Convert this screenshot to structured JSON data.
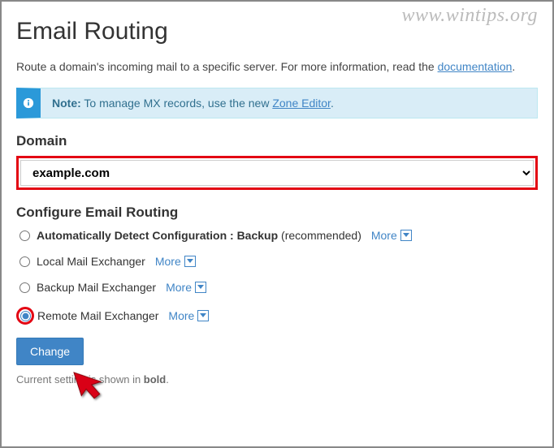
{
  "watermark": "www.wintips.org",
  "page_title": "Email Routing",
  "intro_text_a": "Route a domain's incoming mail to a specific server. For more information, read the ",
  "intro_link": "documentation",
  "intro_text_b": ".",
  "info": {
    "note_label": "Note:",
    "text_a": " To manage MX records, use the new ",
    "link": "Zone Editor",
    "text_b": "."
  },
  "domain": {
    "label": "Domain",
    "selected": "example.com"
  },
  "configure_label": "Configure Email Routing",
  "options": [
    {
      "label": "Automatically Detect Configuration : Backup",
      "recommended": " (recommended)",
      "more": "More"
    },
    {
      "label": "Local Mail Exchanger",
      "more": "More"
    },
    {
      "label": "Backup Mail Exchanger",
      "more": "More"
    },
    {
      "label": "Remote Mail Exchanger",
      "more": "More"
    }
  ],
  "change_button": "Change",
  "hint_a": "Current setting is shown in ",
  "hint_b": "bold",
  "hint_c": "."
}
